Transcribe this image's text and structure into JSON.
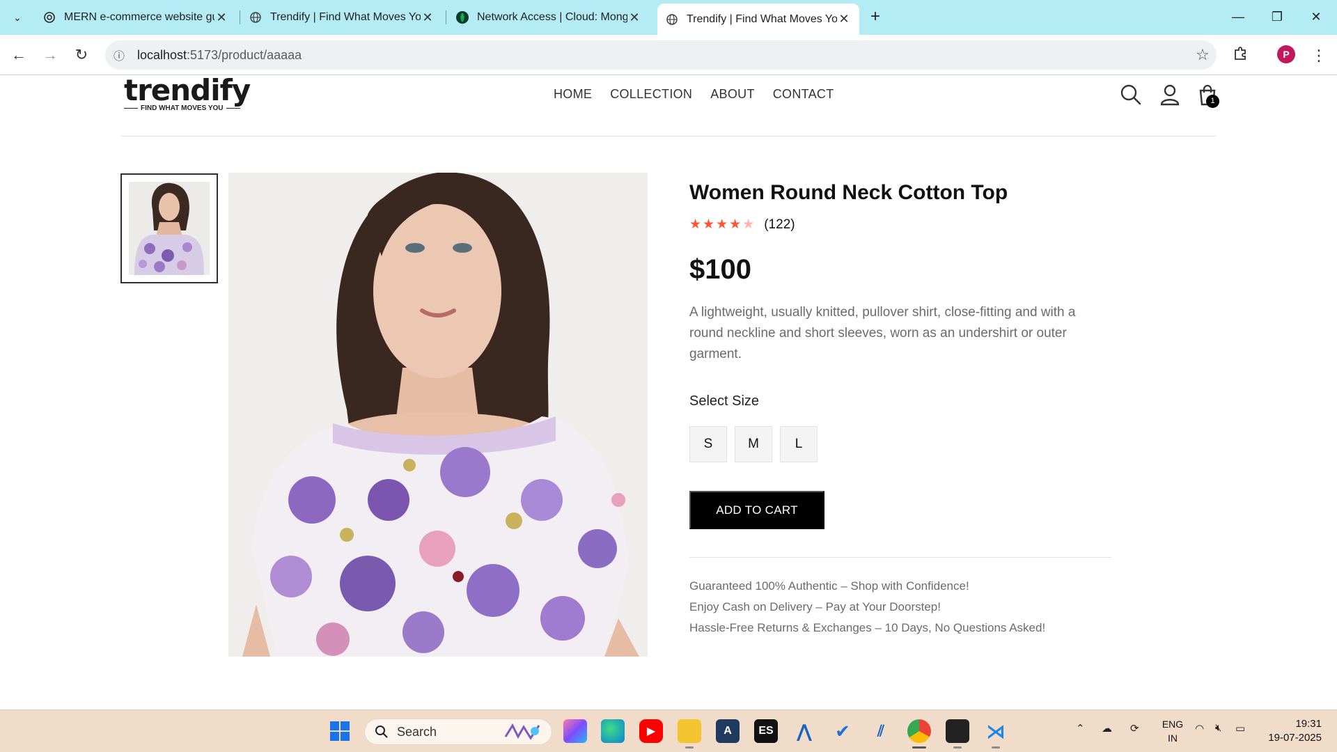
{
  "browser": {
    "tabs": [
      {
        "title": "MERN e-commerce website gui",
        "favicon": "chatgpt-icon",
        "active": false
      },
      {
        "title": "Trendify | Find What Moves You",
        "favicon": "globe-icon",
        "active": false
      },
      {
        "title": "Network Access | Cloud: Mongo",
        "favicon": "mongodb-leaf-icon",
        "active": false
      },
      {
        "title": "Trendify | Find What Moves You",
        "favicon": "globe-icon",
        "active": true
      }
    ],
    "url_host": "localhost",
    "url_path": ":5173/product/aaaaa",
    "profile_initial": "P"
  },
  "header": {
    "logo_word": "trendify",
    "logo_tagline": "FIND WHAT MOVES YOU",
    "nav": [
      "HOME",
      "COLLECTION",
      "ABOUT",
      "CONTACT"
    ],
    "cart_count": "1"
  },
  "product": {
    "title": "Women Round Neck Cotton Top",
    "rating_count": "(122)",
    "rating_stars": 4,
    "rating_max": 5,
    "price": "$100",
    "description": "A lightweight, usually knitted, pullover shirt, close-fitting and with a round neckline and short sleeves, worn as an undershirt or outer garment.",
    "select_size_label": "Select Size",
    "sizes": [
      "S",
      "M",
      "L"
    ],
    "add_to_cart_label": "ADD TO CART",
    "perks": [
      "Guaranteed 100% Authentic – Shop with Confidence!",
      "Enjoy Cash on Delivery – Pay at Your Doorstep!",
      "Hassle-Free Returns & Exchanges – 10 Days, No Questions Asked!"
    ]
  },
  "taskbar": {
    "search_label": "Search",
    "language": "ENG",
    "region": "IN",
    "time": "19:31",
    "date": "19-07-2025"
  },
  "colors": {
    "tabbar_bg": "#b4ecf5",
    "star_color": "#ff5533",
    "taskbar_bg": "#f0dcc9",
    "button_black": "#000000"
  }
}
